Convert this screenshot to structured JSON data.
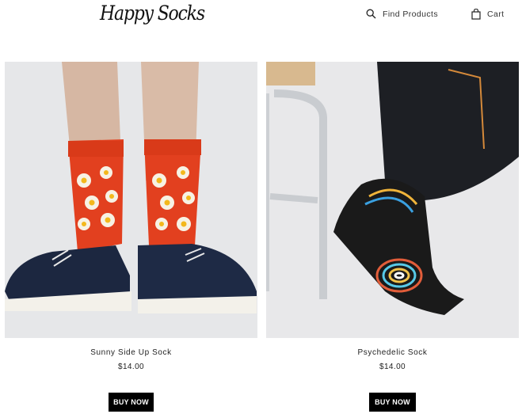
{
  "header": {
    "logo_text": "Happy Socks",
    "search_label": "Find Products",
    "cart_label": "Cart"
  },
  "products": [
    {
      "name": "Sunny Side Up Sock",
      "price": "$14.00",
      "button_label": "BUY NOW"
    },
    {
      "name": "Psychedelic Sock",
      "price": "$14.00",
      "button_label": "BUY NOW"
    }
  ],
  "colors": {
    "button_bg": "#000000",
    "sock_red": "#e2401f",
    "sock_black": "#1a1a1a",
    "background": "#ffffff"
  }
}
